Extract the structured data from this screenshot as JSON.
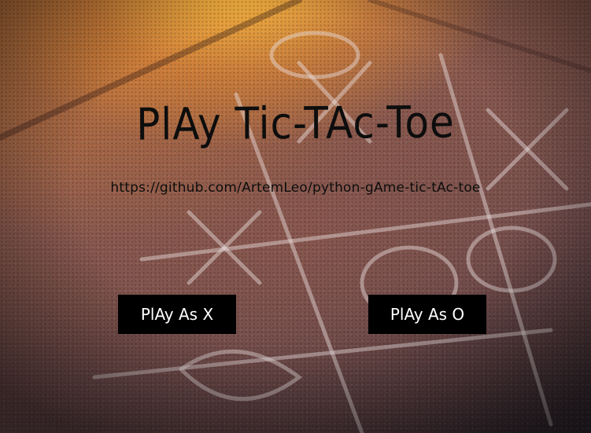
{
  "title": "PlAy Tic-TAc-Toe",
  "repo_link": "https://github.com/ArtemLeo/python-gAme-tic-tAc-toe",
  "buttons": {
    "play_x": "PlAy As X",
    "play_o": "PlAy As O"
  },
  "colors": {
    "button_bg": "#000000",
    "button_text": "#ffffff",
    "title_text": "#0d0d0d"
  }
}
